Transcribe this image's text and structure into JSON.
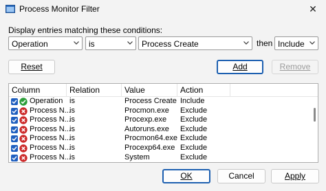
{
  "window": {
    "title": "Process Monitor Filter",
    "close_glyph": "✕"
  },
  "conditions": {
    "label": "Display entries matching these conditions:",
    "column": "Operation",
    "relation": "is",
    "value": "Process Create",
    "then_label": "then",
    "action": "Include"
  },
  "buttons": {
    "reset": "Reset",
    "add": "Add",
    "remove": "Remove",
    "ok": "OK",
    "cancel": "Cancel",
    "apply": "Apply"
  },
  "table": {
    "headers": [
      "Column",
      "Relation",
      "Value",
      "Action"
    ],
    "rows": [
      {
        "column": "Operation",
        "relation": "is",
        "value": "Process Create",
        "action": "Include",
        "icon": "include-check-icon"
      },
      {
        "column": "Process N...",
        "relation": "is",
        "value": "Procmon.exe",
        "action": "Exclude",
        "icon": "exclude-x-icon"
      },
      {
        "column": "Process N...",
        "relation": "is",
        "value": "Procexp.exe",
        "action": "Exclude",
        "icon": "exclude-x-icon"
      },
      {
        "column": "Process N...",
        "relation": "is",
        "value": "Autoruns.exe",
        "action": "Exclude",
        "icon": "exclude-x-icon"
      },
      {
        "column": "Process N...",
        "relation": "is",
        "value": "Procmon64.exe",
        "action": "Exclude",
        "icon": "exclude-x-icon"
      },
      {
        "column": "Process N...",
        "relation": "is",
        "value": "Procexp64.exe",
        "action": "Exclude",
        "icon": "exclude-x-icon"
      },
      {
        "column": "Process N...",
        "relation": "is",
        "value": "System",
        "action": "Exclude",
        "icon": "exclude-x-icon"
      }
    ]
  },
  "colors": {
    "include": "#2e9e3a",
    "exclude": "#cc2a2a",
    "checkbox": "#1f5fbf",
    "focus": "#1c5fb0"
  }
}
